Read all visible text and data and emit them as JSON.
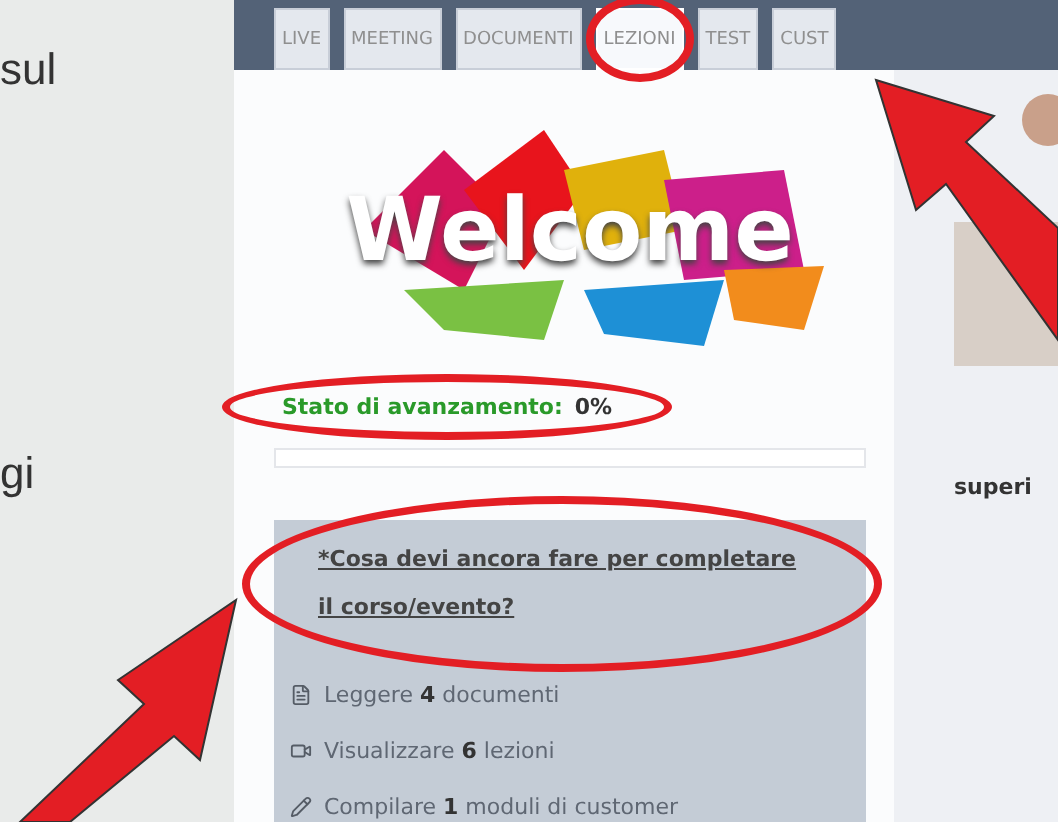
{
  "side_text": [
    "sul",
    "gi"
  ],
  "tabs": [
    {
      "label": "LIVE",
      "selected": false,
      "circled": false
    },
    {
      "label": "MEETING",
      "selected": false,
      "circled": false
    },
    {
      "label": "DOCUMENTI",
      "selected": false,
      "circled": false
    },
    {
      "label": "LEZIONI",
      "selected": true,
      "circled": true
    },
    {
      "label": "TEST",
      "selected": false,
      "circled": false
    },
    {
      "label": "CUST",
      "selected": false,
      "circled": false
    }
  ],
  "logo": {
    "text": "Welcome"
  },
  "progress": {
    "label": "Stato di avanzamento:",
    "value": "0%",
    "level": 0,
    "circled": true
  },
  "todo": {
    "title": "*Cosa devi ancora fare per completare il corso/evento?",
    "circled": true,
    "items": [
      {
        "kind": "document",
        "text": "Leggere **4** documenti"
      },
      {
        "kind": "video",
        "text": "Visualizzare **6** lezioni"
      },
      {
        "kind": "form",
        "text": "Compilare **1** moduli di customer"
      }
    ]
  },
  "side_card": {
    "title": "superi"
  },
  "annotations": [
    {
      "kind": "arrow"
    },
    {
      "kind": "arrow"
    }
  ]
}
